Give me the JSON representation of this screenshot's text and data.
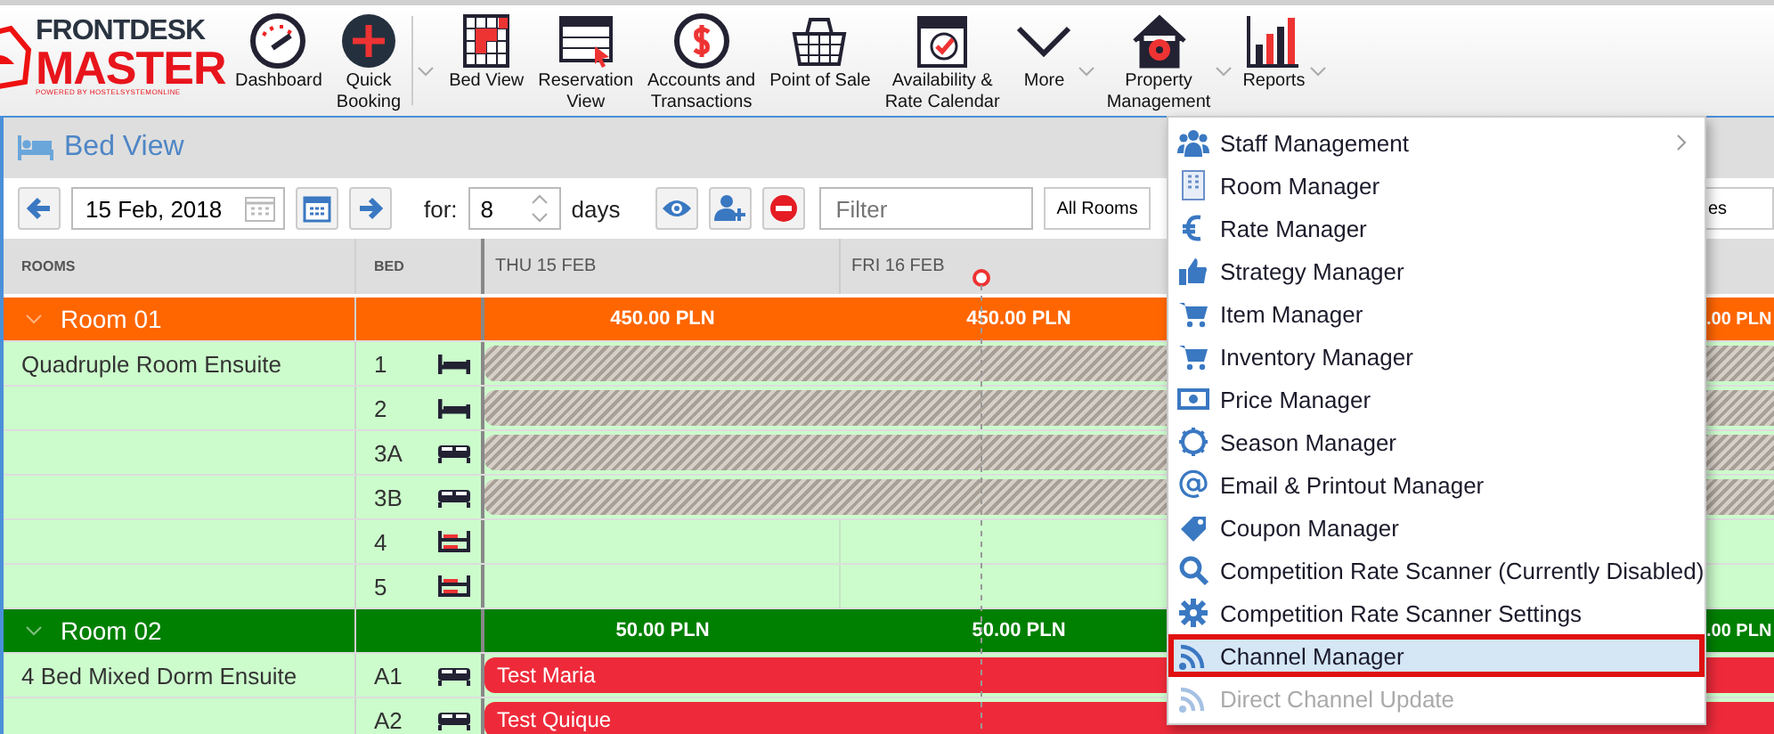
{
  "logo": {
    "brand_top": "FRONTDESK",
    "brand_bottom": "MASTER",
    "tagline": "POWERED BY HOSTELSYSTEMONLINE"
  },
  "toolbar_groups": [
    {
      "caret": false,
      "items": [
        {
          "lines": [
            "Dashboard"
          ],
          "dropdown": false
        },
        {
          "lines": [
            "Quick",
            "Booking"
          ],
          "dropdown": false
        }
      ]
    },
    {
      "caret": true,
      "items": [
        {
          "lines": [
            "Bed View"
          ],
          "dropdown": false
        },
        {
          "lines": [
            "Reservation",
            "View"
          ],
          "dropdown": false
        },
        {
          "lines": [
            "Accounts and",
            "Transactions"
          ],
          "dropdown": false
        },
        {
          "lines": [
            "Point of Sale"
          ],
          "dropdown": false
        },
        {
          "lines": [
            "Availability &",
            "Rate Calendar"
          ],
          "dropdown": false
        },
        {
          "lines": [
            "More"
          ],
          "dropdown": true
        },
        {
          "lines": [
            "Property",
            "Management"
          ],
          "dropdown": true
        },
        {
          "lines": [
            "Reports"
          ],
          "dropdown": true
        }
      ]
    }
  ],
  "page_title": "Bed View",
  "controls": {
    "date": "15 Feb, 2018",
    "for_label": "for:",
    "days_value": "8",
    "days_label": "days",
    "filter_placeholder": "Filter",
    "room_select": "All Rooms",
    "cut_select": "es"
  },
  "columns": {
    "rooms": "ROOMS",
    "bed": "BED",
    "days": [
      "THU 15 FEB",
      "FRI 16 FEB"
    ]
  },
  "rooms": [
    {
      "name": "Room 01",
      "color": "#ff6600",
      "expanded": true,
      "room_type": "Quadruple Room Ensuite",
      "prices": [
        "450.00 PLN",
        "450.00 PLN",
        ".00 PLN"
      ],
      "beds": [
        {
          "bed": "1",
          "kind": "single",
          "booking": {
            "kind": "blocked"
          }
        },
        {
          "bed": "2",
          "kind": "single",
          "booking": {
            "kind": "blocked"
          }
        },
        {
          "bed": "3A",
          "kind": "double",
          "booking": {
            "kind": "blocked"
          }
        },
        {
          "bed": "3B",
          "kind": "double",
          "booking": {
            "kind": "blocked"
          }
        },
        {
          "bed": "4",
          "kind": "bunk"
        },
        {
          "bed": "5",
          "kind": "bunk"
        }
      ]
    },
    {
      "name": "Room 02",
      "color": "#008000",
      "expanded": true,
      "room_type": "4 Bed Mixed Dorm Ensuite",
      "prices": [
        "50.00 PLN",
        "50.00 PLN",
        ".00 PLN"
      ],
      "beds": [
        {
          "bed": "A1",
          "kind": "double",
          "booking": {
            "kind": "reservation",
            "label": "Test Maria"
          }
        },
        {
          "bed": "A2",
          "kind": "double",
          "booking": {
            "kind": "reservation",
            "label": "Test Quique"
          }
        }
      ]
    }
  ],
  "menu": {
    "items": [
      {
        "label": "Staff Management",
        "submenu": true,
        "selected": false,
        "disabled": false
      },
      {
        "label": "Room Manager",
        "submenu": false,
        "selected": false,
        "disabled": false
      },
      {
        "label": "Rate Manager",
        "submenu": false,
        "selected": false,
        "disabled": false
      },
      {
        "label": "Strategy Manager",
        "submenu": false,
        "selected": false,
        "disabled": false
      },
      {
        "label": "Item Manager",
        "submenu": false,
        "selected": false,
        "disabled": false
      },
      {
        "label": "Inventory Manager",
        "submenu": false,
        "selected": false,
        "disabled": false
      },
      {
        "label": "Price Manager",
        "submenu": false,
        "selected": false,
        "disabled": false
      },
      {
        "label": "Season Manager",
        "submenu": false,
        "selected": false,
        "disabled": false
      },
      {
        "label": "Email & Printout Manager",
        "submenu": false,
        "selected": false,
        "disabled": false
      },
      {
        "label": "Coupon Manager",
        "submenu": false,
        "selected": false,
        "disabled": false
      },
      {
        "label": "Competition Rate Scanner (Currently Disabled)",
        "submenu": false,
        "selected": false,
        "disabled": false
      },
      {
        "label": "Competition Rate Scanner Settings",
        "submenu": false,
        "selected": false,
        "disabled": false
      },
      {
        "label": "Channel Manager",
        "submenu": false,
        "selected": true,
        "disabled": false
      },
      {
        "label": "Direct Channel Update",
        "submenu": false,
        "selected": false,
        "disabled": true
      }
    ]
  }
}
